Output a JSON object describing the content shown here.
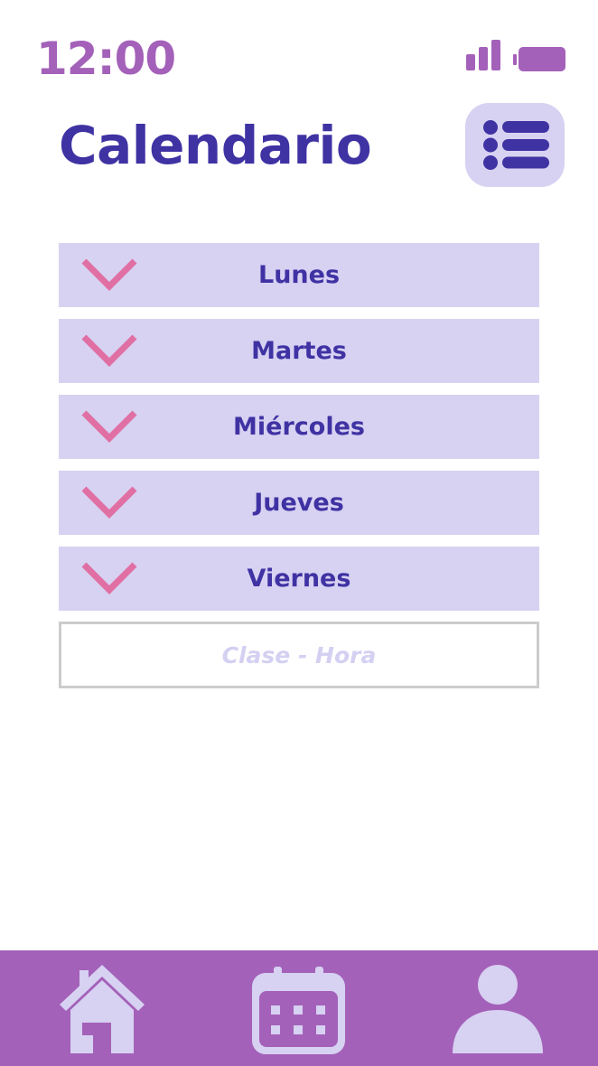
{
  "colors": {
    "primary": "#3f32a3",
    "accent_purple": "#a461b9",
    "light_lavender": "#d7d1f2",
    "chevron_pink": "#e06fa3",
    "placeholder": "#d4d0f2",
    "background": "#ffffff"
  },
  "status_bar": {
    "time": "12:00",
    "signal_icon": "signal-bars-icon",
    "battery_icon": "battery-icon"
  },
  "header": {
    "title": "Calendario",
    "menu_icon": "list-menu-icon"
  },
  "days": [
    {
      "label": "Lunes",
      "icon": "chevron-down-icon"
    },
    {
      "label": "Martes",
      "icon": "chevron-down-icon"
    },
    {
      "label": "Miércoles",
      "icon": "chevron-down-icon"
    },
    {
      "label": "Jueves",
      "icon": "chevron-down-icon"
    },
    {
      "label": "Viernes",
      "icon": "chevron-down-icon"
    }
  ],
  "class_input": {
    "placeholder": "Clase - Hora",
    "value": ""
  },
  "bottom_nav": {
    "items": [
      {
        "icon": "home-icon"
      },
      {
        "icon": "calendar-icon"
      },
      {
        "icon": "user-icon"
      }
    ]
  }
}
